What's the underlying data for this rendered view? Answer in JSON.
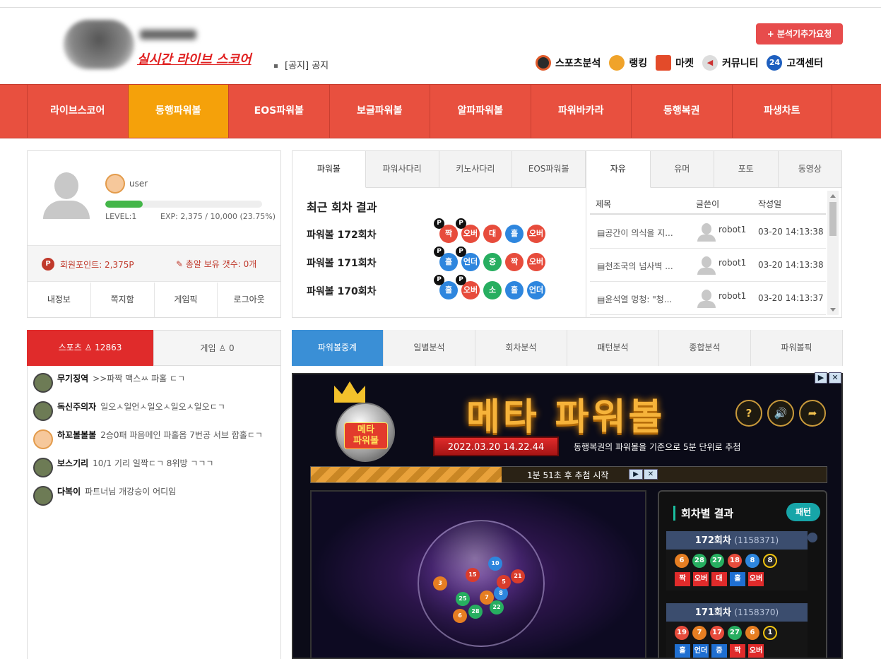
{
  "header": {
    "logo_text": "실시간 라이브 스코어",
    "notice_tag": "[공지]",
    "notice_text": "공지",
    "request_button": "+ 분석기추가요청",
    "top_menu": [
      {
        "label": "스포츠분석",
        "icon": "target-icon"
      },
      {
        "label": "랭킹",
        "icon": "medal-icon"
      },
      {
        "label": "마켓",
        "icon": "shop-icon"
      },
      {
        "label": "커뮤니티",
        "icon": "megaphone-icon"
      },
      {
        "label": "고객센터",
        "icon": "support-24-icon"
      }
    ]
  },
  "nav": {
    "items": [
      "라이브스코어",
      "동행파워볼",
      "EOS파워볼",
      "보글파워볼",
      "알파파워볼",
      "파워바카라",
      "동행복권",
      "파생차트"
    ],
    "active_index": 1
  },
  "profile": {
    "username": "user",
    "level": "LEVEL:1",
    "exp": "EXP: 2,375 / 10,000 (23.75%)",
    "exp_fraction": 0.2375,
    "points": "회원포인트: 2,375P",
    "eggs": "총알 보유 갯수: 0개",
    "links": [
      "내정보",
      "쪽지함",
      "게임픽",
      "로그아웃"
    ]
  },
  "results": {
    "tabs": [
      "파워볼",
      "파워사다리",
      "키노사다리",
      "EOS파워볼"
    ],
    "active_tab": 0,
    "title": "최근 회차 결과",
    "rows": [
      {
        "label": "파워볼 172회차",
        "balls": [
          {
            "t": "짝",
            "c": "red",
            "p": true
          },
          {
            "t": "오버",
            "c": "red",
            "p": true
          },
          {
            "t": "대",
            "c": "red"
          },
          {
            "t": "홀",
            "c": "blue"
          },
          {
            "t": "오버",
            "c": "red"
          }
        ]
      },
      {
        "label": "파워볼 171회차",
        "balls": [
          {
            "t": "홀",
            "c": "blue",
            "p": true
          },
          {
            "t": "언더",
            "c": "blue",
            "p": true
          },
          {
            "t": "중",
            "c": "green"
          },
          {
            "t": "짝",
            "c": "red"
          },
          {
            "t": "오버",
            "c": "red"
          }
        ]
      },
      {
        "label": "파워볼 170회차",
        "balls": [
          {
            "t": "홀",
            "c": "blue",
            "p": true
          },
          {
            "t": "오버",
            "c": "red",
            "p": true
          },
          {
            "t": "소",
            "c": "green"
          },
          {
            "t": "홀",
            "c": "blue"
          },
          {
            "t": "언더",
            "c": "blue"
          }
        ]
      }
    ]
  },
  "board": {
    "tabs": [
      "자유",
      "유머",
      "포토",
      "동영상"
    ],
    "active_tab": 0,
    "headers": {
      "title": "제목",
      "author": "글쓴이",
      "date": "작성일"
    },
    "rows": [
      {
        "title": "공간이 의식을 지...",
        "author": "robot1",
        "date": "03-20 14:13:38"
      },
      {
        "title": "천조국의 넘사벽 ...",
        "author": "robot1",
        "date": "03-20 14:13:38"
      },
      {
        "title": "윤석열 멍청: \"청...",
        "author": "robot1",
        "date": "03-20 14:13:37"
      }
    ]
  },
  "chat": {
    "tabs": [
      {
        "label": "스포츠",
        "count": "12863"
      },
      {
        "label": "게임",
        "count": "0"
      }
    ],
    "messages": [
      {
        "nick": "무기징역",
        "text": ">>파짝 맥스ㅆ 파홀 ㄷㄱ",
        "badge": "level"
      },
      {
        "nick": "독신주의자",
        "text": "일오ㅅ일언ㅅ일오ㅅ일오ㅅ일오ㄷㄱ",
        "badge": "level"
      },
      {
        "nick": "하꼬볼볼볼",
        "text": "2승0패 파음메인 파홀옵 7번공 서브 합홀ㄷㄱ",
        "badge": "new"
      },
      {
        "nick": "보스기리",
        "text": "10/1 기리 일짝ㄷㄱ 8위방 ㄱㄱㄱ",
        "badge": "level"
      },
      {
        "nick": "다복이",
        "text": "파트너님 개강승이 어디임",
        "badge": "level"
      }
    ]
  },
  "analysis_tabs": {
    "items": [
      "파워볼중계",
      "일별분석",
      "회차분석",
      "패턴분석",
      "종합분석",
      "파워볼픽"
    ],
    "active_index": 0
  },
  "game": {
    "title": "메타 파워볼",
    "mascot_label": "메타\n파워볼",
    "datetime": "2022.03.20 14.22.44",
    "description": "동행복권의 파워볼을 기준으로 5분 단위로 추첨",
    "countdown": "1분 51초 후 추첨 시작",
    "countdown_progress": 0.37,
    "round_panel_title": "회차별 결과",
    "pattern_button": "패턴",
    "rounds": [
      {
        "round": "172회차",
        "id": "(1158371)",
        "balls": [
          {
            "n": "6",
            "c": "orange"
          },
          {
            "n": "28",
            "c": "green"
          },
          {
            "n": "27",
            "c": "green"
          },
          {
            "n": "18",
            "c": "red"
          },
          {
            "n": "8",
            "c": "blue"
          },
          {
            "n": "8",
            "c": "black"
          }
        ],
        "tags": [
          {
            "t": "짝",
            "c": "red"
          },
          {
            "t": "오버",
            "c": "red"
          },
          {
            "t": "대",
            "c": "red"
          },
          {
            "t": "홀",
            "c": "blue"
          },
          {
            "t": "오버",
            "c": "red"
          }
        ]
      },
      {
        "round": "171회차",
        "id": "(1158370)",
        "balls": [
          {
            "n": "19",
            "c": "red"
          },
          {
            "n": "7",
            "c": "orange"
          },
          {
            "n": "17",
            "c": "red"
          },
          {
            "n": "27",
            "c": "green"
          },
          {
            "n": "6",
            "c": "orange"
          },
          {
            "n": "1",
            "c": "black"
          }
        ],
        "tags": [
          {
            "t": "홀",
            "c": "blue"
          },
          {
            "t": "언더",
            "c": "blue"
          },
          {
            "t": "중",
            "c": "blue"
          },
          {
            "t": "짝",
            "c": "red"
          },
          {
            "t": "오버",
            "c": "red"
          }
        ]
      }
    ],
    "globe_balls": [
      {
        "n": "3",
        "c": "orange"
      },
      {
        "n": "15",
        "c": "red"
      },
      {
        "n": "10",
        "c": "blue"
      },
      {
        "n": "21",
        "c": "red"
      },
      {
        "n": "25",
        "c": "green"
      },
      {
        "n": "7",
        "c": "orange"
      },
      {
        "n": "8",
        "c": "blue"
      },
      {
        "n": "28",
        "c": "green"
      },
      {
        "n": "22",
        "c": "green"
      },
      {
        "n": "6",
        "c": "orange"
      },
      {
        "n": "5",
        "c": "red"
      }
    ]
  }
}
